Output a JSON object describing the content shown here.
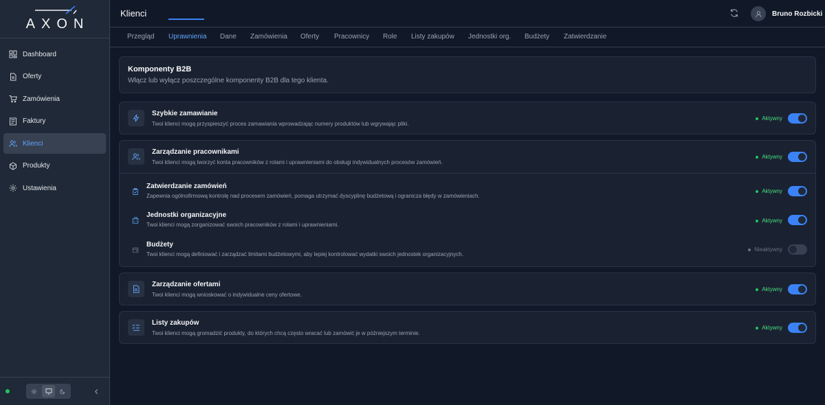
{
  "app": {
    "logo_text": "AXON"
  },
  "sidebar": {
    "items": [
      {
        "label": "Dashboard",
        "icon": "dashboard-icon"
      },
      {
        "label": "Oferty",
        "icon": "document-icon"
      },
      {
        "label": "Zamówienia",
        "icon": "cart-icon"
      },
      {
        "label": "Faktury",
        "icon": "invoice-icon"
      },
      {
        "label": "Klienci",
        "icon": "users-icon",
        "active": true
      },
      {
        "label": "Produkty",
        "icon": "box-icon"
      },
      {
        "label": "Ustawienia",
        "icon": "gear-icon"
      }
    ],
    "theme_options": [
      "light",
      "system",
      "dark"
    ],
    "theme_selected": "system"
  },
  "header": {
    "title": "Klienci",
    "user_name": "Bruno Rozbicki"
  },
  "tabs": [
    {
      "label": "Przegląd"
    },
    {
      "label": "Uprawnienia",
      "active": true
    },
    {
      "label": "Dane"
    },
    {
      "label": "Zamówienia"
    },
    {
      "label": "Oferty"
    },
    {
      "label": "Pracownicy"
    },
    {
      "label": "Role"
    },
    {
      "label": "Listy zakupów"
    },
    {
      "label": "Jednostki org."
    },
    {
      "label": "Budżety"
    },
    {
      "label": "Zatwierdzanie"
    }
  ],
  "intro": {
    "title": "Komponenty B2B",
    "description": "Włącz lub wyłącz poszczególne komponenty B2B dla tego klienta."
  },
  "status_labels": {
    "active": "Aktywny",
    "inactive": "Nieaktywny"
  },
  "features": {
    "quick_order": {
      "title": "Szybkie zamawianie",
      "description": "Twoi klienci mogą przyspieszyć proces zamawiania wprowadzając numery produktów lub wgrywając pliki.",
      "enabled": true,
      "icon": "lightning-icon"
    },
    "employees": {
      "title": "Zarządzanie pracownikami",
      "description": "Twoi klienci mogą tworzyć konta pracowników z rolami i uprawnieniami do obsługi indywidualnych procesów zamówień.",
      "enabled": true,
      "icon": "users-icon"
    },
    "approvals": {
      "title": "Zatwierdzanie zamówień",
      "description": "Zapewnia ogólnofirmową kontrolę nad procesem zamówień, pomaga utrzymać dyscyplinę budżetową i ogranicza błędy w zamówieniach.",
      "enabled": true,
      "icon": "clipboard-check-icon"
    },
    "org_units": {
      "title": "Jednostki organizacyjne",
      "description": "Twoi klienci mogą zorganizować swoich pracowników z rolami i uprawnieniami.",
      "enabled": true,
      "icon": "building-icon"
    },
    "budgets": {
      "title": "Budżety",
      "description": "Twoi klienci mogą definiować i zarządzać limitami budżetowymi, aby lepiej kontrolować wydatki swoich jednostek organizacyjnych.",
      "enabled": false,
      "icon": "wallet-icon"
    },
    "quotes": {
      "title": "Zarządzanie ofertami",
      "description": "Twoi klienci mogą wnioskować o indywidualne ceny ofertowe.",
      "enabled": true,
      "icon": "document-icon"
    },
    "shopping_lists": {
      "title": "Listy zakupów",
      "description": "Twoi klienci mogą gromadzić produkty, do których chcą często wracać lub zamówić je w późniejszym terminie.",
      "enabled": true,
      "icon": "list-check-icon"
    }
  },
  "colors": {
    "accent": "#3b82f6",
    "active_status": "#4ade80",
    "background": "#111827",
    "sidebar": "#1f2937"
  }
}
